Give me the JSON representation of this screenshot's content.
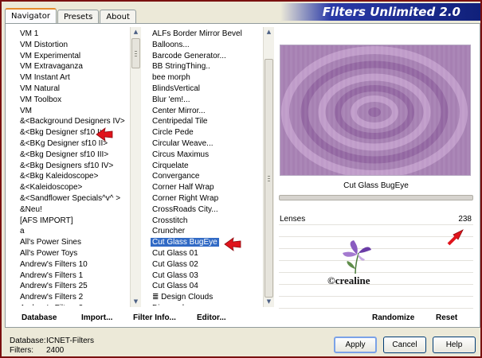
{
  "window": {
    "title": "Filters Unlimited 2.0",
    "tabs": [
      "Navigator",
      "Presets",
      "About"
    ],
    "active_tab": "Navigator"
  },
  "categories": {
    "items": [
      "VM 1",
      "VM Distortion",
      "VM Experimental",
      "VM Extravaganza",
      "VM Instant Art",
      "VM Natural",
      "VM Toolbox",
      "VM",
      "&<Background Designers IV>",
      "&<Bkg Designer sf10 I>",
      "&<BKg Designer sf10 II>",
      "&<Bkg Designer sf10 III>",
      "&<Bkg Designers sf10 IV>",
      "&<Bkg Kaleidoscope>",
      "&<Kaleidoscope>",
      "&<Sandflower Specials^v^ >",
      "&Neu!",
      "[AFS IMPORT]",
      "a",
      "All's Power Sines",
      "All's Power Toys",
      "Andrew's Filters 10",
      "Andrew's Filters 1",
      "Andrew's Filters 25",
      "Andrew's Filters 2",
      "Andrew's Filters 3"
    ],
    "marked_item": "&<Bkg Designer sf10 I>"
  },
  "filters": {
    "items": [
      "ALFs Border Mirror Bevel",
      "Balloons...",
      "Barcode Generator...",
      "BB StringThing..",
      "bee morph",
      "BlindsVertical",
      "Blur 'em!...",
      "Center Mirror...",
      "Centripedal Tile",
      "Circle Pede",
      "Circular Weave...",
      "Circus Maximus",
      "Cirquelate",
      "Convergance",
      "Corner Half Wrap",
      "Corner Right Wrap",
      "CrossRoads City...",
      "Crosstitch",
      "Cruncher",
      "Cut Glass  BugEye",
      "Cut Glass 01",
      "Cut Glass 02",
      "Cut Glass 03",
      "Cut Glass 04",
      "Design Clouds",
      "Diamonds"
    ],
    "selected_item": "Cut Glass  BugEye",
    "group_marker": "≣"
  },
  "links": {
    "database": "Database",
    "import": "Import...",
    "filter_info": "Filter Info...",
    "editor": "Editor...",
    "randomize": "Randomize",
    "reset": "Reset"
  },
  "preview": {
    "filter_name": "Cut Glass  BugEye",
    "color": "#a67db0"
  },
  "parameters": [
    {
      "label": "Lenses",
      "value": "238"
    }
  ],
  "status": {
    "database_label": "Database:",
    "database_value": "ICNET-Filters",
    "filters_label": "Filters:",
    "filters_value": "2400"
  },
  "buttons": {
    "apply": "Apply",
    "cancel": "Cancel",
    "help": "Help"
  },
  "watermark": {
    "text": "©crealine"
  },
  "colors": {
    "accent": "#316ac5",
    "arrow": "#e0141c",
    "frame": "#7a1010",
    "title_bar": "#10207a"
  }
}
